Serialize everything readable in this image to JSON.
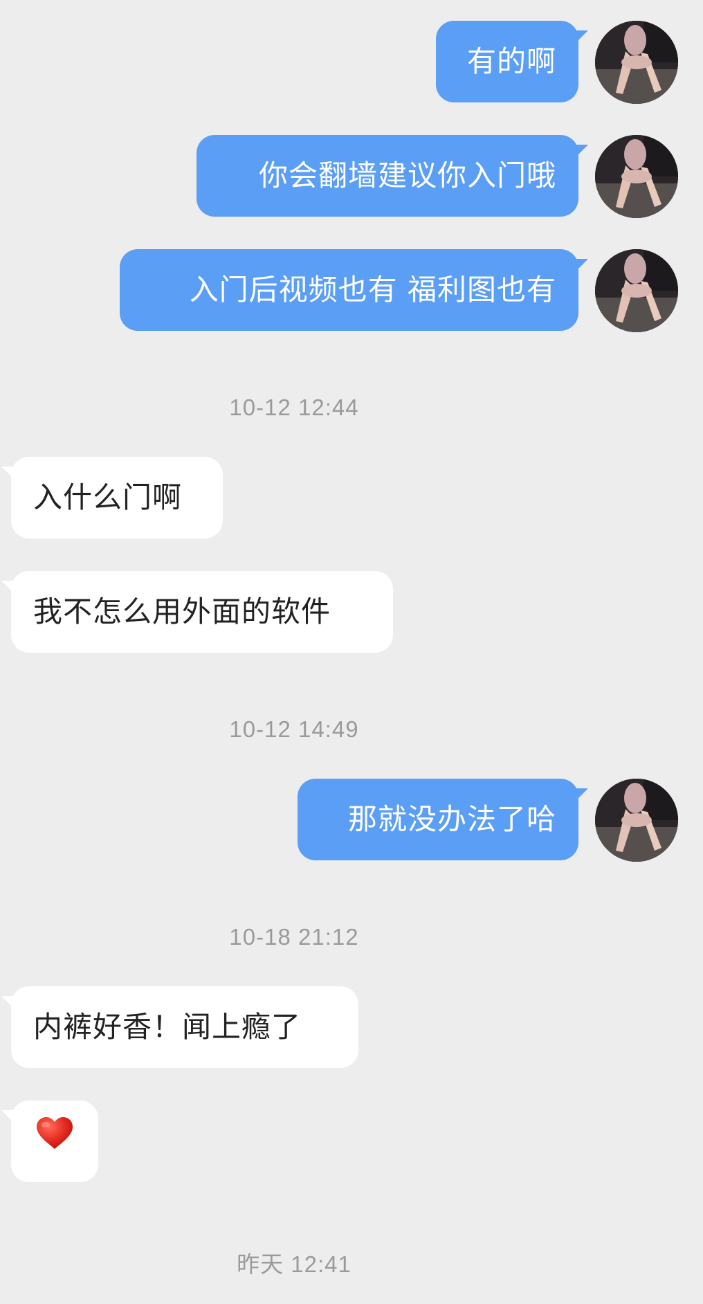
{
  "colors": {
    "background": "#ededed",
    "outgoing_bubble": "#5b9ef6",
    "incoming_bubble": "#ffffff"
  },
  "messages": [
    {
      "side": "out",
      "text": "有的啊"
    },
    {
      "side": "out",
      "text": "你会翻墙建议你入门哦"
    },
    {
      "side": "out",
      "text": "入门后视频也有 福利图也有"
    },
    {
      "side": "time",
      "text": "10-12 12:44"
    },
    {
      "side": "in",
      "text": "入什么门啊"
    },
    {
      "side": "in",
      "text": "我不怎么用外面的软件"
    },
    {
      "side": "time",
      "text": "10-12 14:49"
    },
    {
      "side": "out",
      "text": "那就没办法了哈"
    },
    {
      "side": "time",
      "text": "10-18 21:12"
    },
    {
      "side": "in",
      "text": "内裤好香！闻上瘾了"
    },
    {
      "side": "in",
      "icon": "heart-emoji-icon"
    },
    {
      "side": "time",
      "text": "昨天 12:41"
    }
  ]
}
